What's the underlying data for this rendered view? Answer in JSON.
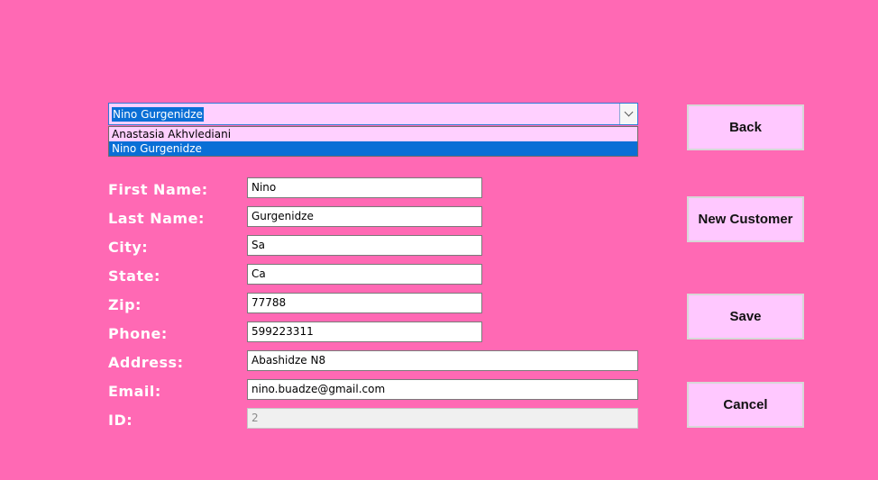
{
  "customer_combo": {
    "selected_value": "Nino Gurgenidze",
    "options": [
      "Anastasia Akhvlediani",
      "Nino Gurgenidze"
    ],
    "highlighted_index": 1
  },
  "form": {
    "first_name": {
      "label": "First Name:",
      "value": "Nino"
    },
    "last_name": {
      "label": "Last Name:",
      "value": "Gurgenidze"
    },
    "city": {
      "label": "City:",
      "value": "Sa"
    },
    "state": {
      "label": "State:",
      "value": "Ca"
    },
    "zip": {
      "label": "Zip:",
      "value": "77788"
    },
    "phone": {
      "label": "Phone:",
      "value": "599223311"
    },
    "address": {
      "label": "Address:",
      "value": "Abashidze N8"
    },
    "email": {
      "label": "Email:",
      "value": "nino.buadze@gmail.com"
    },
    "id": {
      "label": "ID:",
      "value": "2"
    }
  },
  "buttons": {
    "back": "Back",
    "new_customer": "New Customer",
    "save": "Save",
    "cancel": "Cancel"
  },
  "colors": {
    "background": "#ff69b4",
    "button_bg": "#ffc8ff",
    "selection": "#0a6fd6"
  }
}
